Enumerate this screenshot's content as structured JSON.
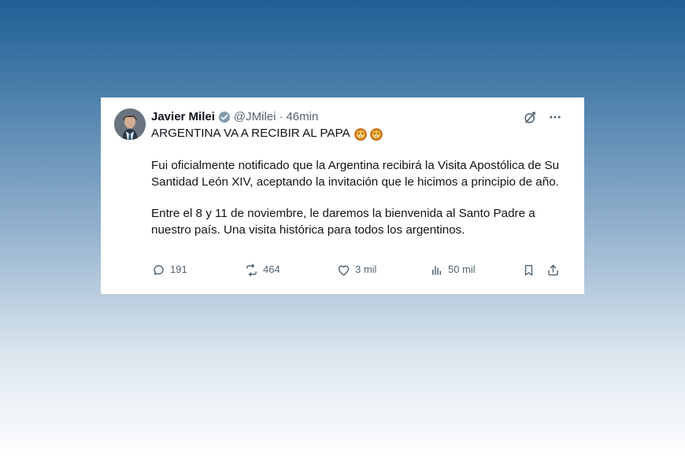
{
  "tweet": {
    "author": {
      "display_name": "Javier Milei",
      "handle": "@JMilei",
      "separator": "·",
      "time": "46min"
    },
    "title": "ARGENTINA VA A RECIBIR AL PAPA",
    "paragraphs": [
      "Fui oficialmente notificado que la Argentina recibirá la Visita Apostólica de Su Santidad León XIV, aceptando la invitación que le hicimos a principio de año.",
      "Entre el 8 y 11 de noviembre, le daremos la bienvenida al Santo Padre a nuestro país. Una visita histórica para todos los argentinos."
    ],
    "emoji_icons": [
      "lion-icon",
      "lion-icon"
    ],
    "metrics": {
      "replies": "191",
      "reposts": "464",
      "likes": "3 mil",
      "views": "50 mil"
    }
  },
  "icons": {
    "verified": "verified-icon",
    "grok": "grok-icon",
    "more": "more-icon",
    "reply": "reply-icon",
    "repost": "repost-icon",
    "like": "heart-icon",
    "views": "views-icon",
    "bookmark": "bookmark-icon",
    "share": "share-icon"
  },
  "colors": {
    "verified": "#829aab",
    "text": "#0f1419",
    "secondary_text": "#536471",
    "card_background": "#ffffff"
  }
}
